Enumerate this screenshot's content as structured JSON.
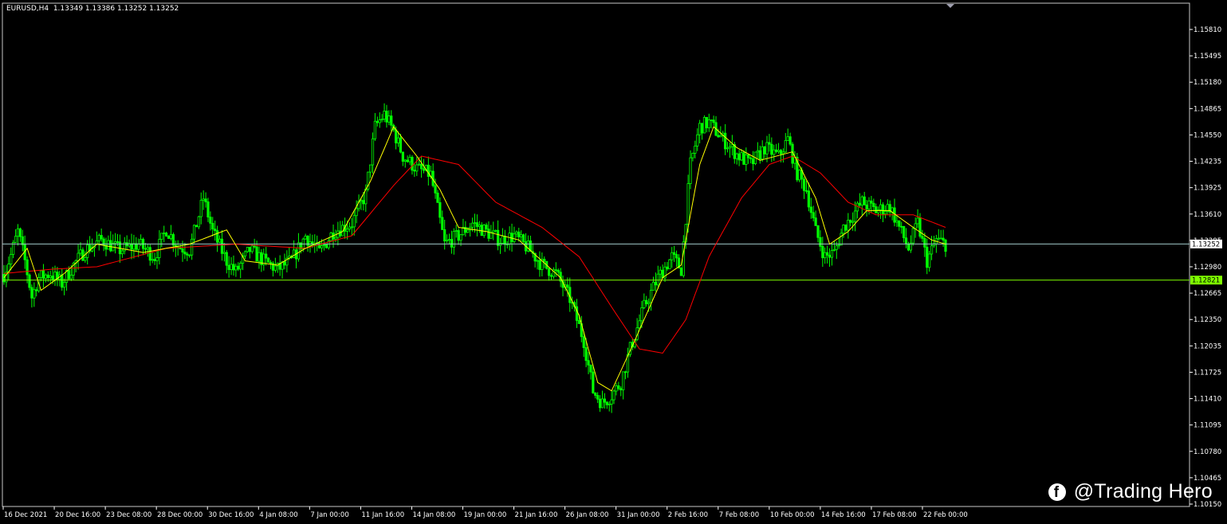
{
  "header": {
    "symbol_line": "EURUSD,H4  1.13349 1.13386 1.13252 1.13252"
  },
  "watermark": {
    "icon": "facebook-icon",
    "text": "@Trading Hero"
  },
  "colors": {
    "background": "#000000",
    "candle": "#00ff00",
    "ma_fast": "#ffff00",
    "ma_slow": "#ff0000",
    "bid_line": "#a0c8c8",
    "support_line": "#7fff00",
    "support_tag": "#7fff00",
    "bid_tag": "#ffffff",
    "axis": "#ffffff"
  },
  "chart_data": {
    "type": "candlestick",
    "title": "EURUSD,H4",
    "ohlc_readout": {
      "open": 1.13349,
      "high": 1.13386,
      "low": 1.13252,
      "close": 1.13252
    },
    "y_ticks": [
      "1.15810",
      "1.15495",
      "1.15180",
      "1.14865",
      "1.14550",
      "1.14235",
      "1.13925",
      "1.13610",
      "1.13295",
      "1.12980",
      "1.12665",
      "1.12350",
      "1.12035",
      "1.11725",
      "1.11410",
      "1.11095",
      "1.10780",
      "1.10465",
      "1.10150"
    ],
    "ylim": [
      1.1015,
      1.1612
    ],
    "x_ticks": [
      "16 Dec 2021",
      "20 Dec 16:00",
      "23 Dec 08:00",
      "28 Dec 00:00",
      "30 Dec 16:00",
      "4 Jan 08:00",
      "7 Jan 00:00",
      "11 Jan 16:00",
      "14 Jan 08:00",
      "19 Jan 00:00",
      "21 Jan 16:00",
      "26 Jan 08:00",
      "31 Jan 00:00",
      "2 Feb 16:00",
      "7 Feb 08:00",
      "10 Feb 00:00",
      "14 Feb 16:00",
      "17 Feb 08:00",
      "22 Feb 00:00"
    ],
    "bid_price": {
      "value": 1.13252,
      "label": "1.13252"
    },
    "horizontal_line": {
      "value": 1.12821,
      "label": "1.12821"
    },
    "price_path_keypoints": [
      [
        0,
        1.1289
      ],
      [
        3,
        1.1312
      ],
      [
        6,
        1.134
      ],
      [
        9,
        1.1305
      ],
      [
        12,
        1.1262
      ],
      [
        15,
        1.1285
      ],
      [
        20,
        1.129
      ],
      [
        25,
        1.1278
      ],
      [
        30,
        1.13
      ],
      [
        35,
        1.1318
      ],
      [
        42,
        1.133
      ],
      [
        50,
        1.1318
      ],
      [
        58,
        1.1325
      ],
      [
        65,
        1.131
      ],
      [
        70,
        1.1343
      ],
      [
        75,
        1.1322
      ],
      [
        80,
        1.1318
      ],
      [
        86,
        1.138
      ],
      [
        90,
        1.134
      ],
      [
        96,
        1.1305
      ],
      [
        100,
        1.1292
      ],
      [
        106,
        1.1318
      ],
      [
        112,
        1.1305
      ],
      [
        118,
        1.1295
      ],
      [
        124,
        1.1305
      ],
      [
        130,
        1.1335
      ],
      [
        136,
        1.1315
      ],
      [
        142,
        1.134
      ],
      [
        150,
        1.135
      ],
      [
        156,
        1.1385
      ],
      [
        160,
        1.1465
      ],
      [
        164,
        1.148
      ],
      [
        168,
        1.146
      ],
      [
        172,
        1.143
      ],
      [
        178,
        1.1415
      ],
      [
        184,
        1.1408
      ],
      [
        190,
        1.1325
      ],
      [
        196,
        1.1335
      ],
      [
        202,
        1.135
      ],
      [
        208,
        1.134
      ],
      [
        214,
        1.133
      ],
      [
        220,
        1.1335
      ],
      [
        226,
        1.132
      ],
      [
        232,
        1.13
      ],
      [
        238,
        1.129
      ],
      [
        244,
        1.126
      ],
      [
        250,
        1.121
      ],
      [
        254,
        1.115
      ],
      [
        258,
        1.1135
      ],
      [
        262,
        1.1145
      ],
      [
        266,
        1.116
      ],
      [
        270,
        1.12
      ],
      [
        276,
        1.125
      ],
      [
        282,
        1.1285
      ],
      [
        288,
        1.131
      ],
      [
        292,
        1.1295
      ],
      [
        296,
        1.142
      ],
      [
        300,
        1.1465
      ],
      [
        304,
        1.147
      ],
      [
        310,
        1.145
      ],
      [
        316,
        1.1432
      ],
      [
        322,
        1.142
      ],
      [
        328,
        1.144
      ],
      [
        334,
        1.143
      ],
      [
        338,
        1.145
      ],
      [
        342,
        1.141
      ],
      [
        346,
        1.139
      ],
      [
        350,
        1.134
      ],
      [
        354,
        1.131
      ],
      [
        358,
        1.1315
      ],
      [
        362,
        1.1345
      ],
      [
        366,
        1.136
      ],
      [
        370,
        1.1375
      ],
      [
        376,
        1.1365
      ],
      [
        382,
        1.137
      ],
      [
        386,
        1.1345
      ],
      [
        390,
        1.132
      ],
      [
        394,
        1.135
      ],
      [
        398,
        1.1305
      ],
      [
        402,
        1.133
      ],
      [
        406,
        1.1325
      ]
    ],
    "ma_fast_keypoints": [
      [
        0,
        1.1285
      ],
      [
        10,
        1.132
      ],
      [
        16,
        1.127
      ],
      [
        26,
        1.129
      ],
      [
        40,
        1.1325
      ],
      [
        60,
        1.1315
      ],
      [
        80,
        1.1325
      ],
      [
        96,
        1.1342
      ],
      [
        104,
        1.1305
      ],
      [
        118,
        1.13
      ],
      [
        130,
        1.132
      ],
      [
        146,
        1.134
      ],
      [
        158,
        1.14
      ],
      [
        168,
        1.1465
      ],
      [
        178,
        1.143
      ],
      [
        188,
        1.139
      ],
      [
        196,
        1.1345
      ],
      [
        208,
        1.134
      ],
      [
        222,
        1.133
      ],
      [
        232,
        1.1305
      ],
      [
        240,
        1.1285
      ],
      [
        248,
        1.124
      ],
      [
        256,
        1.116
      ],
      [
        262,
        1.115
      ],
      [
        272,
        1.121
      ],
      [
        284,
        1.1285
      ],
      [
        292,
        1.13
      ],
      [
        300,
        1.142
      ],
      [
        306,
        1.1465
      ],
      [
        316,
        1.144
      ],
      [
        326,
        1.1425
      ],
      [
        340,
        1.1435
      ],
      [
        350,
        1.138
      ],
      [
        356,
        1.1325
      ],
      [
        364,
        1.134
      ],
      [
        372,
        1.1365
      ],
      [
        382,
        1.1365
      ],
      [
        392,
        1.1345
      ],
      [
        400,
        1.133
      ],
      [
        406,
        1.1325
      ]
    ],
    "ma_slow_keypoints": [
      [
        0,
        1.129
      ],
      [
        20,
        1.1295
      ],
      [
        40,
        1.1298
      ],
      [
        70,
        1.132
      ],
      [
        100,
        1.1325
      ],
      [
        130,
        1.132
      ],
      [
        150,
        1.1335
      ],
      [
        168,
        1.1395
      ],
      [
        180,
        1.143
      ],
      [
        196,
        1.142
      ],
      [
        212,
        1.1375
      ],
      [
        232,
        1.1345
      ],
      [
        248,
        1.131
      ],
      [
        262,
        1.125
      ],
      [
        274,
        1.12
      ],
      [
        284,
        1.1195
      ],
      [
        294,
        1.1235
      ],
      [
        304,
        1.131
      ],
      [
        318,
        1.138
      ],
      [
        330,
        1.142
      ],
      [
        340,
        1.143
      ],
      [
        352,
        1.141
      ],
      [
        364,
        1.1375
      ],
      [
        376,
        1.136
      ],
      [
        392,
        1.136
      ],
      [
        406,
        1.1345
      ]
    ]
  }
}
